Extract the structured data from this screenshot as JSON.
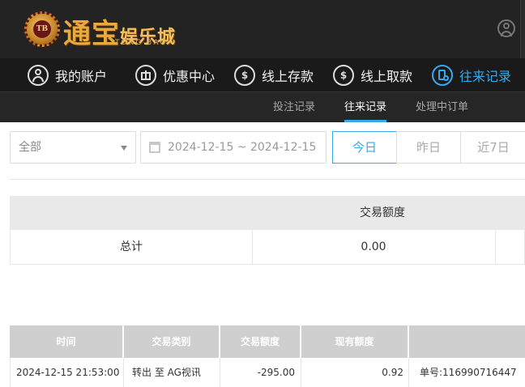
{
  "header": {
    "logo_badge": "TB",
    "logo_title_1": "通",
    "logo_title_2": "宝",
    "logo_title_3": "娱乐城",
    "logo_subtitle": "TONG BAO"
  },
  "nav": {
    "items": [
      {
        "label": "我的账户",
        "icon": "user-circle-icon"
      },
      {
        "label": "优惠中心",
        "icon": "gift-icon"
      },
      {
        "label": "线上存款",
        "icon": "deposit-icon"
      },
      {
        "label": "线上取款",
        "icon": "withdraw-icon"
      },
      {
        "label": "往来记录",
        "icon": "records-icon",
        "active": true
      }
    ]
  },
  "subnav": {
    "items": [
      {
        "label": "投注记录"
      },
      {
        "label": "往来记录",
        "active": true
      },
      {
        "label": "处理中订单"
      }
    ]
  },
  "filters": {
    "type_select": "全部",
    "date_range": "2024-12-15 ~ 2024-12-15",
    "quick": [
      "今日",
      "昨日",
      "近7日"
    ]
  },
  "summary": {
    "column": "交易额度",
    "row_label": "总计",
    "row_value": "0.00"
  },
  "details": {
    "columns": [
      "时间",
      "交易类别",
      "交易额度",
      "现有额度",
      ""
    ],
    "rows": [
      {
        "time": "2024-12-15 21:53:00",
        "type": "转出 至 AG视讯",
        "amount": "-295.00",
        "balance": "0.92",
        "note": "单号:116990716447"
      }
    ]
  },
  "colors": {
    "accent": "#38a8ec",
    "header_bg": "#232323",
    "nav_bg": "#1a1a1a"
  }
}
